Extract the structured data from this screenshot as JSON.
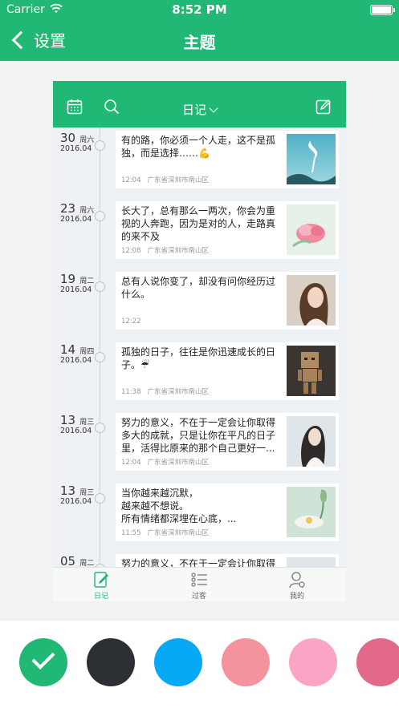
{
  "status_bar": {
    "carrier": "Carrier",
    "time": "8:52 PM"
  },
  "nav": {
    "back_label": "设置",
    "title": "主题"
  },
  "preview": {
    "header_title": "日记",
    "entries": [
      {
        "day": "30",
        "weekday": "周六",
        "year_month": "2016.04",
        "text": "有的路，你必须一个人走，这不是孤独，而是选择……💪",
        "time": "12:04",
        "location": "广东省深圳市南山区"
      },
      {
        "day": "23",
        "weekday": "周六",
        "year_month": "2016.04",
        "text": "长大了，总有那么一两次，你会为重视的人奔跑，因为是对的人，走路真的来不及",
        "time": "12:08",
        "location": "广东省深圳市南山区"
      },
      {
        "day": "19",
        "weekday": "周二",
        "year_month": "2016.04",
        "text": "总有人说你变了，却没有问你经历过什么。",
        "time": "12:22",
        "location": ""
      },
      {
        "day": "14",
        "weekday": "周四",
        "year_month": "2016.04",
        "text": "孤独的日子，往往是你迅速成长的日子。☔",
        "time": "11:38",
        "location": "广东省深圳市南山区"
      },
      {
        "day": "13",
        "weekday": "周三",
        "year_month": "2016.04",
        "text": "努力的意义，不在于一定会让你取得多大的成就，只是让你在平凡的日子里，活得比原来的那个自己更好一...",
        "time": "12:04",
        "location": "广东省深圳市南山区"
      },
      {
        "day": "13",
        "weekday": "周三",
        "year_month": "2016.04",
        "text": "当你越来越沉默，\n越来越不想说。\n所有情绪都深埋在心底，...",
        "time": "11:55",
        "location": "广东省深圳市南山区"
      },
      {
        "day": "05",
        "weekday": "周二",
        "year_month": "",
        "text": "努力的意义，不在于一定会让你取得",
        "time": "",
        "location": ""
      }
    ],
    "tabs": [
      {
        "label": "日记",
        "icon": "diary-icon"
      },
      {
        "label": "过客",
        "icon": "list-icon"
      },
      {
        "label": "我的",
        "icon": "user-settings-icon"
      }
    ]
  },
  "swatches": [
    {
      "color": "#20b874",
      "selected": true
    },
    {
      "color": "#2c3035",
      "selected": false
    },
    {
      "color": "#08a9f4",
      "selected": false
    },
    {
      "color": "#f4939e",
      "selected": false
    },
    {
      "color": "#fba5c6",
      "selected": false
    },
    {
      "color": "#e26a88",
      "selected": false
    }
  ],
  "colors": {
    "accent": "#20b874"
  }
}
